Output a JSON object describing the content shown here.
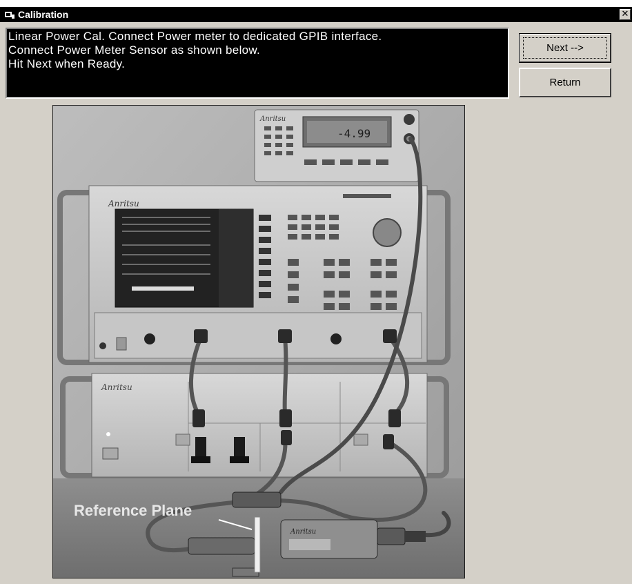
{
  "window": {
    "title": "Calibration",
    "close_glyph": "✕"
  },
  "instructions": {
    "lines": [
      "Linear Power Cal. Connect Power meter to dedicated GPIB interface.",
      "Connect Power Meter Sensor as shown below.",
      "Hit Next when Ready."
    ]
  },
  "buttons": {
    "next_label": "Next -->",
    "return_label": "Return"
  },
  "photo": {
    "brand": "Anritsu",
    "meter_reading": "-4.99",
    "annotation": "Reference Plane"
  },
  "icons": [
    "calibration-app-icon",
    "close-icon"
  ]
}
